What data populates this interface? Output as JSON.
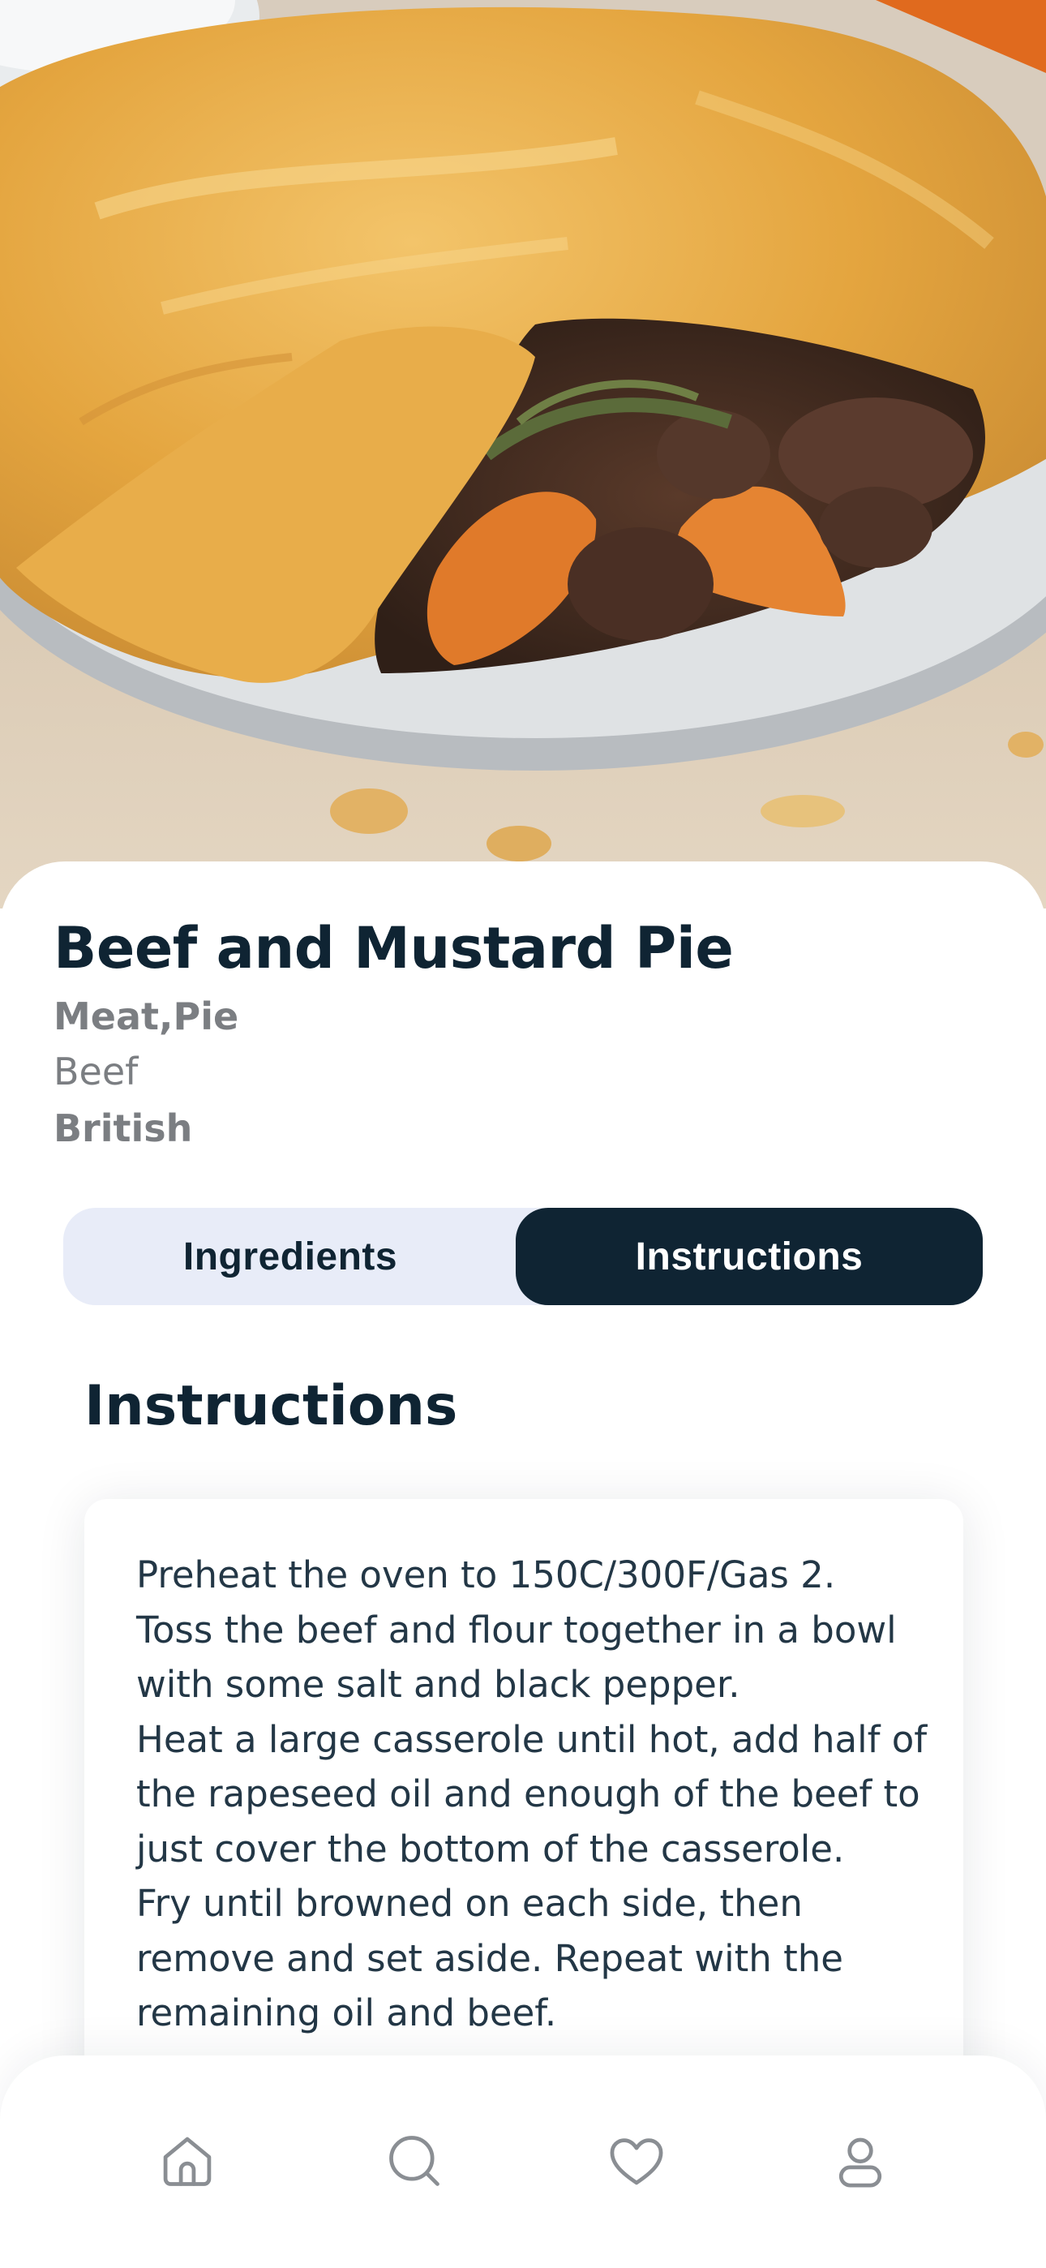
{
  "recipe": {
    "title": "Beef and Mustard Pie",
    "tags": "Meat,Pie",
    "main_ingredient": "Beef",
    "area": "British",
    "hero_image": "beef-and-mustard-pie-photo"
  },
  "tabs": {
    "items": [
      {
        "label": "Ingredients",
        "active": false
      },
      {
        "label": "Instructions",
        "active": true
      }
    ]
  },
  "instructions": {
    "heading": "Instructions",
    "text": "Preheat the oven to 150C/300F/Gas 2.\nToss the beef and flour together in a bowl with some salt and black pepper.\nHeat a large casserole until hot, add half of the rapeseed oil and enough of the beef to just cover the bottom of the casserole.\nFry until browned on each side, then remove and set aside. Repeat with the remaining oil and beef."
  },
  "bottom_nav": {
    "items": [
      {
        "icon": "home-icon"
      },
      {
        "icon": "search-icon"
      },
      {
        "icon": "heart-icon"
      },
      {
        "icon": "profile-icon"
      }
    ]
  },
  "colors": {
    "primary": "#0f2433",
    "muted": "#7b7e82",
    "tab_track": "#e8ecf8",
    "icon": "#8a8e93"
  }
}
